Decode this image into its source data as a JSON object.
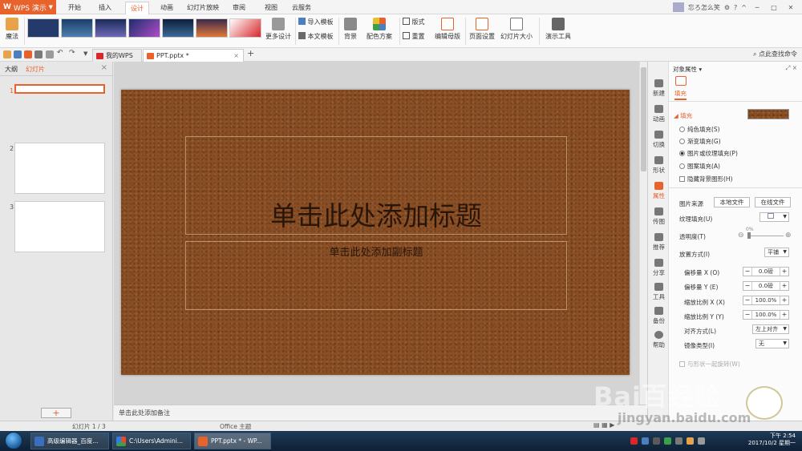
{
  "app": {
    "name": "WPS 演示",
    "logo": "W"
  },
  "menu_tabs": [
    "开始",
    "插入",
    "设计",
    "动画",
    "幻灯片放映",
    "审阅",
    "视图",
    "云服务"
  ],
  "active_menu_tab": "设计",
  "title_right": {
    "account": "忘ろ怎么笑"
  },
  "ribbon": {
    "magic": "魔法",
    "more_designs": "更多设计",
    "import_template": "导入模板",
    "this_template": "本文模板",
    "background": "背景",
    "color_scheme": "配色方案",
    "layout": "版式",
    "reset": "重置",
    "edit_master": "编辑母版",
    "page_setup": "页面设置",
    "slide_size": "幻灯片大小",
    "presentation_tools": "演示工具"
  },
  "doc_tabs": [
    {
      "label": "我的WPS"
    },
    {
      "label": "PPT.pptx *"
    }
  ],
  "search_help": "点此查找命令",
  "left_panel": {
    "tabs": [
      "大纲",
      "幻灯片"
    ],
    "active_tab": "幻灯片",
    "slide_numbers": [
      "1",
      "2",
      "3"
    ],
    "add_label": "+"
  },
  "slide": {
    "title_placeholder": "单击此处添加标题",
    "subtitle_placeholder": "单击此处添加副标题"
  },
  "notes_placeholder": "单击此处添加备注",
  "side_strip": [
    "新建",
    "动画",
    "切换",
    "形状",
    "属性",
    "传图",
    "推荐",
    "分享",
    "工具",
    "备份",
    "帮助"
  ],
  "properties": {
    "header": "对象属性",
    "tab": "填充",
    "section": "填充",
    "fill_options": [
      "纯色填充(S)",
      "渐变填充(G)",
      "图片或纹理填充(P)",
      "图案填充(A)"
    ],
    "selected_fill": "图片或纹理填充(P)",
    "hide_background": "隐藏背景图形(H)",
    "picture_source": "图片来源",
    "local_file": "本地文件",
    "online_file": "在线文件",
    "texture_fill": "纹理填充(U)",
    "transparency": "透明度(T)",
    "transparency_value": "0%",
    "placement": "放置方式(I)",
    "placement_value": "平铺",
    "offset_x": "偏移量 X (O)",
    "offset_x_value": "0.0磅",
    "offset_y": "偏移量 Y (E)",
    "offset_y_value": "0.0磅",
    "scale_x": "缩放比例 X (X)",
    "scale_x_value": "100.0%",
    "scale_y": "缩放比例 Y (Y)",
    "scale_y_value": "100.0%",
    "align": "对齐方式(L)",
    "align_value": "左上对齐",
    "mirror": "镜像类型(I)",
    "mirror_value": "无",
    "rotate_with_shape": "与形状一起旋转(W)"
  },
  "statusbar": {
    "slide_info": "幻灯片 1 / 3",
    "theme": "Office 主题"
  },
  "taskbar": {
    "tasks": [
      "高级编辑器_百度...",
      "C:\\Users\\Admini...",
      "PPT.pptx * - WP..."
    ],
    "time": "下午 2:54",
    "date": "2017/10/2 星期一"
  },
  "watermark": {
    "text": "Bai百经验",
    "sub": "jingyan.baidu.com"
  },
  "colors": {
    "accent": "#e8622c",
    "leather": "#8a4e24"
  }
}
